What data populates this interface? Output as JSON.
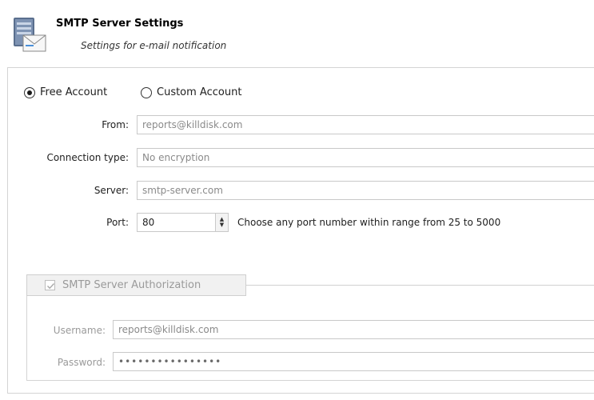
{
  "header": {
    "title": "SMTP Server Settings",
    "subtitle": "Settings for e-mail notification",
    "icon": "server-mail-icon"
  },
  "account": {
    "free_label": "Free Account",
    "custom_label": "Custom Account",
    "selected": "free"
  },
  "form": {
    "from_label": "From:",
    "from_value": "reports@killdisk.com",
    "connection_label": "Connection type:",
    "connection_value": "No encryption",
    "server_label": "Server:",
    "server_value": "smtp-server.com",
    "port_label": "Port:",
    "port_value": "80",
    "port_hint": "Choose any port number within range from 25 to 5000"
  },
  "auth": {
    "group_label": "SMTP Server Authorization",
    "checked": true,
    "username_label": "Username:",
    "username_value": "reports@killdisk.com",
    "password_label": "Password:",
    "password_value": "••••••••••••••••"
  }
}
